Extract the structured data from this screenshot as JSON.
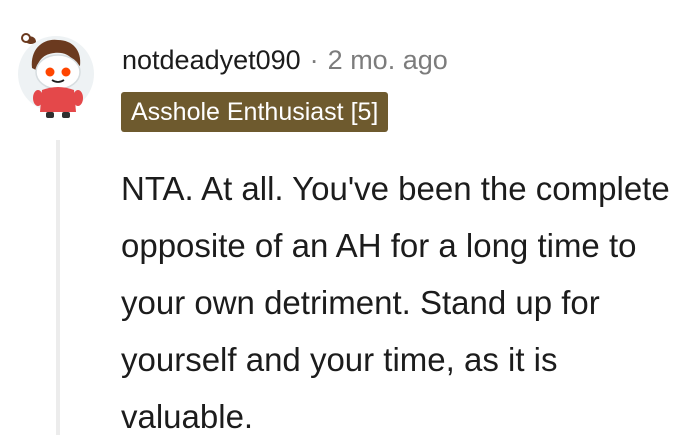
{
  "comment": {
    "username": "notdeadyet090",
    "separator": "·",
    "timestamp": "2 mo. ago",
    "flair": "Asshole Enthusiast [5]",
    "body": "NTA. At all. You've been the complete opposite of an AH for a long time to your own detriment. Stand up for yourself and your time, as it is valuable."
  },
  "colors": {
    "flair_background": "#6e5a2e",
    "thread_line": "#ececec",
    "meta_gray": "#7c7c7c"
  },
  "icons": {
    "avatar": "reddit-snoo-avatar-icon"
  }
}
